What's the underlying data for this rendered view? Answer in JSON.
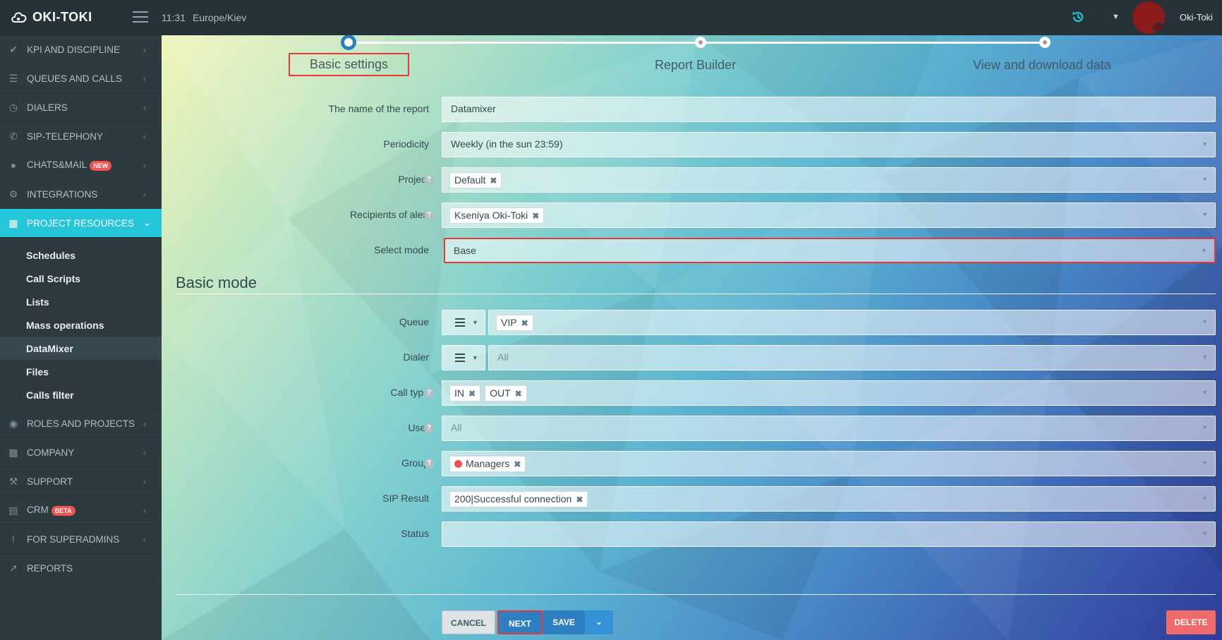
{
  "header": {
    "logo": "OKI-TOKI",
    "time": "11:31",
    "timezone": "Europe/Kiev",
    "user": "Oki-Toki"
  },
  "sidebar": {
    "items": [
      {
        "label": "KPI AND DISCIPLINE",
        "icon": "check-icon"
      },
      {
        "label": "QUEUES AND CALLS",
        "icon": "list-icon"
      },
      {
        "label": "DIALERS",
        "icon": "clock-icon"
      },
      {
        "label": "SIP-TELEPHONY",
        "icon": "phone-icon"
      },
      {
        "label": "CHATS&MAIL",
        "icon": "chat-icon",
        "badge": "NEW"
      },
      {
        "label": "INTEGRATIONS",
        "icon": "gears-icon"
      },
      {
        "label": "PROJECT RESOURCES",
        "icon": "grid-icon"
      }
    ],
    "sub_items": [
      "Schedules",
      "Call Scripts",
      "Lists",
      "Mass operations",
      "DataMixer",
      "Files",
      "Calls filter"
    ],
    "items2": [
      {
        "label": "ROLES AND PROJECTS",
        "icon": "toggle-icon"
      },
      {
        "label": "COMPANY",
        "icon": "bar-chart-icon"
      },
      {
        "label": "SUPPORT",
        "icon": "wrench-icon"
      },
      {
        "label": "CRM",
        "icon": "crm-icon",
        "badge": "BETA"
      },
      {
        "label": "FOR SUPERADMINS",
        "icon": "exclamation-icon"
      },
      {
        "label": "REPORTS",
        "icon": "line-chart-icon"
      }
    ]
  },
  "steps": [
    "Basic settings",
    "Report Builder",
    "View and download data"
  ],
  "form": {
    "report_name_label": "The name of the report",
    "report_name_value": "Datamixer",
    "periodicity_label": "Periodicity",
    "periodicity_value": "Weekly (in the sun 23:59)",
    "project_label": "Project",
    "project_tag": "Default",
    "recipients_label": "Recipients of alert",
    "recipients_tag": "Kseniya Oki-Toki",
    "mode_label": "Select mode",
    "mode_value": "Base"
  },
  "basic_mode": {
    "title": "Basic mode",
    "queue_label": "Queue",
    "queue_tag": "VIP",
    "dialer_label": "Dialer",
    "dialer_value": "All",
    "call_type_label": "Call type",
    "call_type_tags": [
      "IN",
      "OUT"
    ],
    "user_label": "User",
    "user_value": "All",
    "group_label": "Group",
    "group_tag": "Managers",
    "sip_label": "SIP Result",
    "sip_tag": "200|Successful connection",
    "status_label": "Status"
  },
  "buttons": {
    "cancel": "CANCEL",
    "next": "NEXT",
    "save": "SAVE",
    "delete": "DELETE"
  },
  "colors": {
    "accent": "#26c6da",
    "primary": "#2d7fc1",
    "danger": "#ef6b6b",
    "highlight": "#e53935"
  }
}
